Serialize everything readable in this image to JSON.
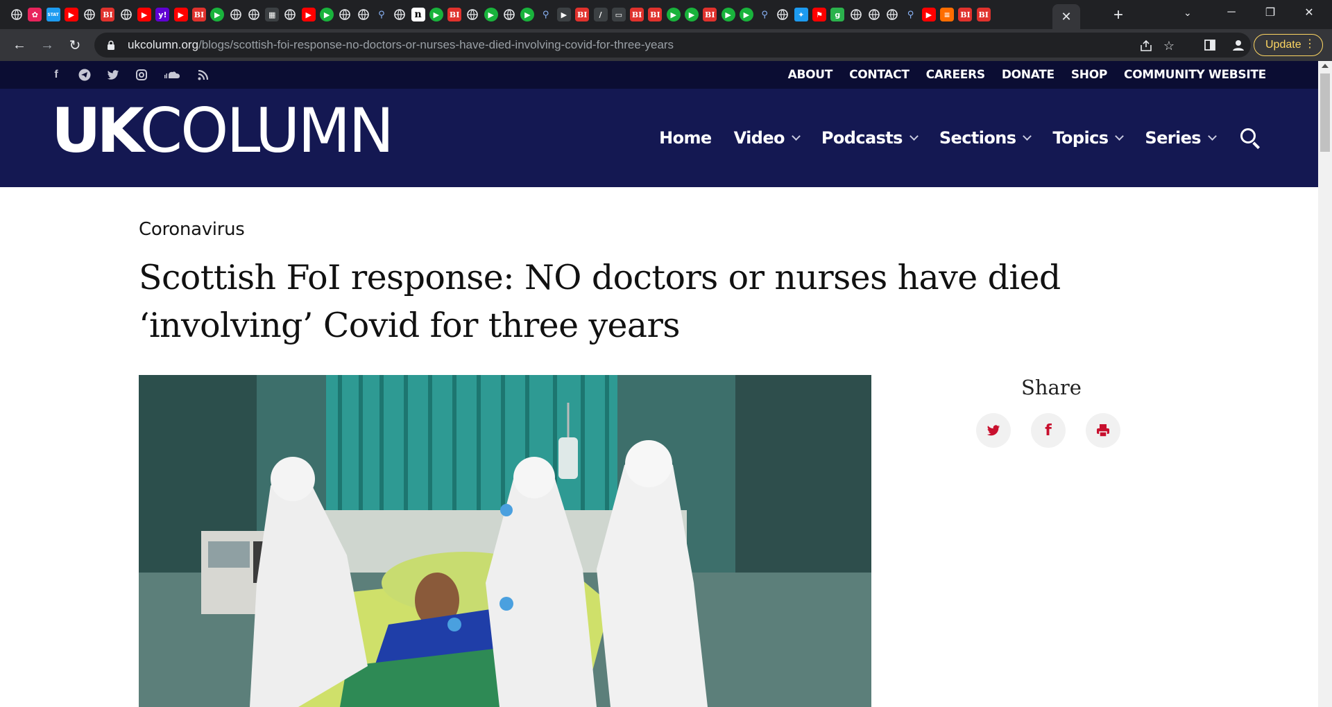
{
  "browser": {
    "url_host": "ukcolumn.org",
    "url_path": "/blogs/scottish-foi-response-no-doctors-or-nurses-have-died-involving-covid-for-three-years",
    "update_label": "Update",
    "tab_icons": [
      "globe-icon",
      "pinwheel-icon",
      "stat-icon",
      "youtube-icon",
      "globe-icon",
      "bi-icon",
      "globe-icon",
      "youtube-icon",
      "yahoo-icon",
      "youtube-icon",
      "bi-icon",
      "play-icon",
      "globe-icon",
      "globe-icon",
      "image-icon",
      "globe-icon",
      "youtube-icon",
      "play-icon",
      "globe-icon",
      "globe-icon",
      "search-icon",
      "globe-icon",
      "n-icon",
      "play-icon",
      "bi-icon",
      "globe-icon",
      "play-icon",
      "globe-icon",
      "play-icon",
      "search-icon",
      "arrow-icon",
      "bi-icon",
      "text-icon",
      "doc-icon",
      "bi-icon",
      "bi-icon",
      "play-icon",
      "play-icon",
      "bi-icon",
      "play-icon",
      "play-icon",
      "search-icon",
      "globe-icon",
      "twitter-icon",
      "pin-icon",
      "g-icon",
      "globe-icon",
      "globe-icon",
      "globe-icon",
      "search-icon",
      "youtube-icon",
      "bookmark-icon",
      "bi-icon",
      "bi-icon"
    ],
    "bi_label": "BI",
    "stat_label": "STAT",
    "yahoo_label": "y!",
    "n_label": "n",
    "g_label": "g"
  },
  "site": {
    "social_icons": [
      "facebook-icon",
      "telegram-icon",
      "twitter-icon",
      "instagram-icon",
      "soundcloud-icon",
      "rss-icon"
    ],
    "top_links": [
      "ABOUT",
      "CONTACT",
      "CAREERS",
      "DONATE",
      "SHOP",
      "COMMUNITY WEBSITE"
    ],
    "logo_bold": "UK",
    "logo_light": "COLUMN",
    "nav": [
      {
        "label": "Home",
        "dropdown": false
      },
      {
        "label": "Video",
        "dropdown": true
      },
      {
        "label": "Podcasts",
        "dropdown": true
      },
      {
        "label": "Sections",
        "dropdown": true
      },
      {
        "label": "Topics",
        "dropdown": true
      },
      {
        "label": "Series",
        "dropdown": true
      }
    ],
    "colors": {
      "topbar": "#0b0d33",
      "navbar": "#141852",
      "share_icon": "#c8102e"
    }
  },
  "article": {
    "category": "Coronavirus",
    "headline_line1": "Scottish FoI response: NO doctors or nurses have died",
    "headline_line2": "‘involving’ Covid for three years",
    "share_title": "Share",
    "share_buttons": [
      "twitter-icon",
      "facebook-icon",
      "print-icon"
    ]
  }
}
